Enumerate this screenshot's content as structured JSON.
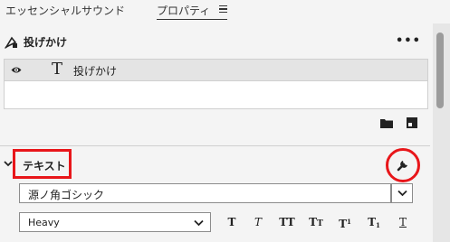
{
  "tabs": {
    "essential_sound": "エッセンシャルサウンド",
    "properties": "プロパティ"
  },
  "layer_section": {
    "title": "投げかけ",
    "more": "•••",
    "layers": [
      {
        "name": "投げかけ",
        "type_glyph": "T"
      }
    ]
  },
  "text_section": {
    "title": "テキスト",
    "font_family": "源ノ角ゴシック",
    "font_weight": "Heavy",
    "style_buttons": {
      "bold": "T",
      "italic": "T",
      "all_caps": "TT",
      "small_caps_big": "T",
      "small_caps_small": "T",
      "superscript_base": "T",
      "superscript_mark": "1",
      "subscript_base": "T",
      "subscript_mark": "1",
      "underline": "T"
    }
  },
  "colors": {
    "highlight": "#e8161a",
    "panel_bg": "#f4f4f4",
    "selected_row": "#e4e4e4"
  }
}
